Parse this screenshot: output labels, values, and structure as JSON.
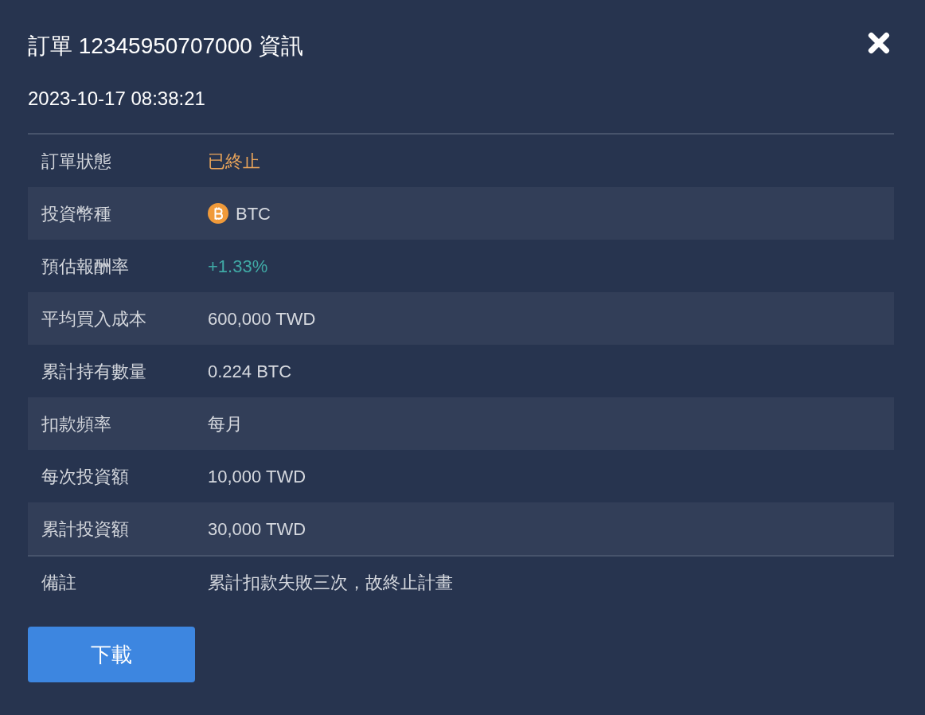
{
  "dialog": {
    "title": "訂單 12345950707000 資訊",
    "timestamp": "2023-10-17 08:38:21"
  },
  "rows": [
    {
      "label": "訂單狀態",
      "value": "已終止",
      "kind": "status"
    },
    {
      "label": "投資幣種",
      "value": "BTC",
      "kind": "coin"
    },
    {
      "label": "預估報酬率",
      "value": "+1.33%",
      "kind": "gain"
    },
    {
      "label": "平均買入成本",
      "value": "600,000 TWD",
      "kind": "text"
    },
    {
      "label": "累計持有數量",
      "value": "0.224 BTC",
      "kind": "text"
    },
    {
      "label": "扣款頻率",
      "value": "每月",
      "kind": "text"
    },
    {
      "label": "每次投資額",
      "value": "10,000 TWD",
      "kind": "text"
    },
    {
      "label": "累計投資額",
      "value": "30,000 TWD",
      "kind": "text"
    }
  ],
  "note": {
    "label": "備註",
    "value": "累計扣款失敗三次，故終止計畫"
  },
  "buttons": [
    {
      "label": "下載"
    }
  ]
}
